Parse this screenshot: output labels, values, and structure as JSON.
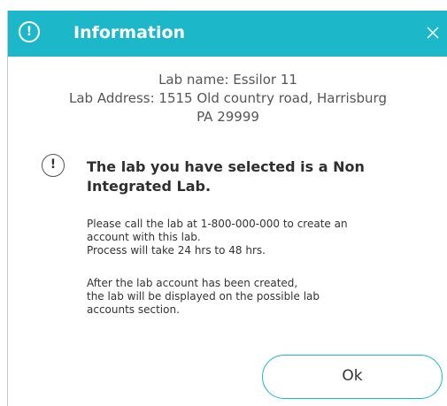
{
  "dialog": {
    "title": "Information",
    "title_icon": "exclamation-circle-icon",
    "close_icon": "close-icon",
    "accent_color": "#1cb8c9",
    "lab_info": {
      "name_line": "Lab name: Essilor 11",
      "address_line1": "Lab Address: 1515 Old country road, Harrisburg",
      "address_line2": "PA 29999"
    },
    "warning_icon": "exclamation-circle-icon",
    "heading_line1": "The lab you have selected is a Non",
    "heading_line2": "Integrated Lab.",
    "paragraph1": [
      "Please call the lab at 1-800-000-000 to create an",
      "account with this lab.",
      "Process will take 24 hrs to 48 hrs."
    ],
    "paragraph2": [
      "After the lab account has been created,",
      "the lab will be displayed on the possible lab",
      "accounts section."
    ],
    "ok_label": "Ok"
  }
}
